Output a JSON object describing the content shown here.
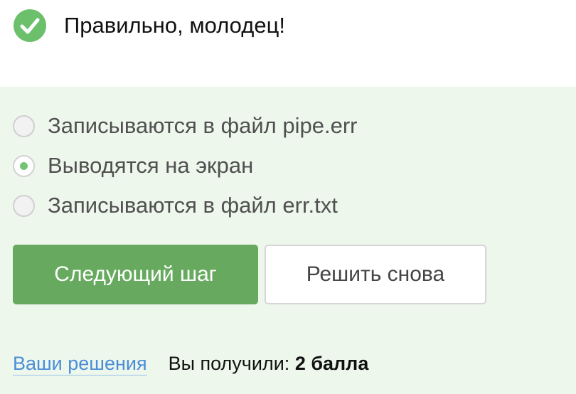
{
  "feedback": {
    "text": "Правильно, молодец!",
    "icon": "check-circle-icon",
    "color": "#6cc06c"
  },
  "options": [
    {
      "label": "Записываются в файл pipe.err",
      "selected": false
    },
    {
      "label": "Выводятся на экран",
      "selected": true
    },
    {
      "label": "Записываются в файл err.txt",
      "selected": false
    }
  ],
  "buttons": {
    "next_label": "Следующий шаг",
    "retry_label": "Решить снова"
  },
  "footer": {
    "solutions_link": "Ваши решения",
    "score_prefix": "Вы получили:",
    "score_value": "2 балла"
  },
  "colors": {
    "panel_bg": "#edf7ec",
    "accent_green": "#67aa5f",
    "link_blue": "#4a8ed8"
  }
}
